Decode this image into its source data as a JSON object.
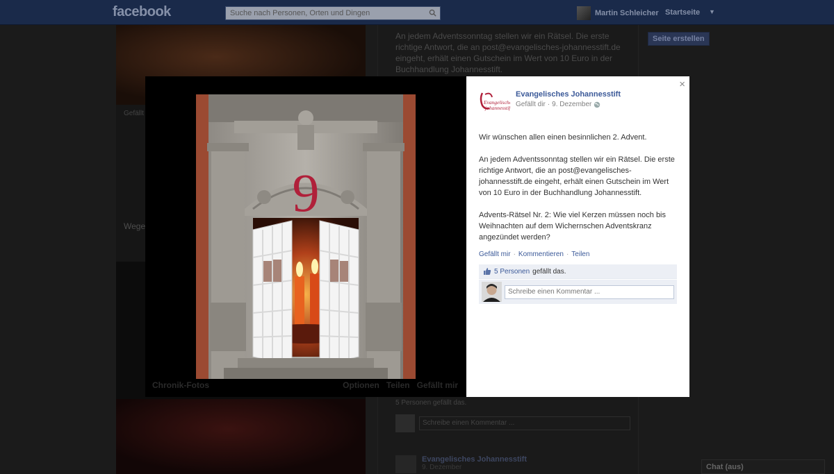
{
  "topbar": {
    "logo": "facebook",
    "search_placeholder": "Suche nach Personen, Orten und Dingen",
    "user_name": "Martin Schleicher",
    "home_label": "Startseite"
  },
  "background": {
    "right_post_text": "An jedem Adventssonntag stellen wir ein Rätsel. Die erste richtige Antwort, die an post@evangelisches-johannesstift.de eingeht, erhält einen Gutschein im Wert von 10 Euro in der Buchhandlung Johannesstift.",
    "create_page_button": "Seite erstellen",
    "left_like_text": "Gefällt ...",
    "left_body_text": "Wege... Türch... aber n...",
    "likes_text": "5 Personen gefällt das.",
    "comment_placeholder": "Schreibe einen Kommentar ...",
    "post2_name": "Evangelisches Johannesstift",
    "post2_date": "9. Dezember",
    "chat_label": "Chat (aus)"
  },
  "lightbox": {
    "stage_footer_left": "Chronik-Fotos",
    "stage_footer_options": "Optionen",
    "stage_footer_share": "Teilen",
    "stage_footer_like": "Gefällt mir",
    "door_number": "9",
    "close_symbol": "×",
    "page_name": "Evangelisches Johannesstift",
    "page_logo_text": "Evangelisches johannesstift",
    "liked_label": "Gefällt dir",
    "date": "9. Dezember",
    "post_paragraphs": [
      "Wir wünschen allen einen besinnlichen 2. Advent.",
      "An jedem Adventssonntag stellen wir ein Rätsel. Die erste richtige Antwort, die an post@evangelisches-johannesstift.de eingeht, erhält einen Gutschein im Wert von 10 Euro in der Buchhandlung Johannesstift.",
      "Advents-Rätsel Nr. 2: Wie viel Kerzen müssen noch bis Weihnachten auf dem Wichernschen Adventskranz angezündet werden?"
    ],
    "actions": {
      "like": "Gefällt mir",
      "comment": "Kommentieren",
      "share": "Teilen"
    },
    "likes_count": "5 Personen",
    "likes_suffix": "gefällt das.",
    "comment_placeholder": "Schreibe einen Kommentar ..."
  },
  "colors": {
    "brand_blue": "#3b5998",
    "topbar": "#1a2a4a",
    "logo_red": "#b0203a"
  },
  "icons": [
    "search-icon",
    "close-icon",
    "globe-icon",
    "like-icon",
    "chevron-down-icon"
  ]
}
